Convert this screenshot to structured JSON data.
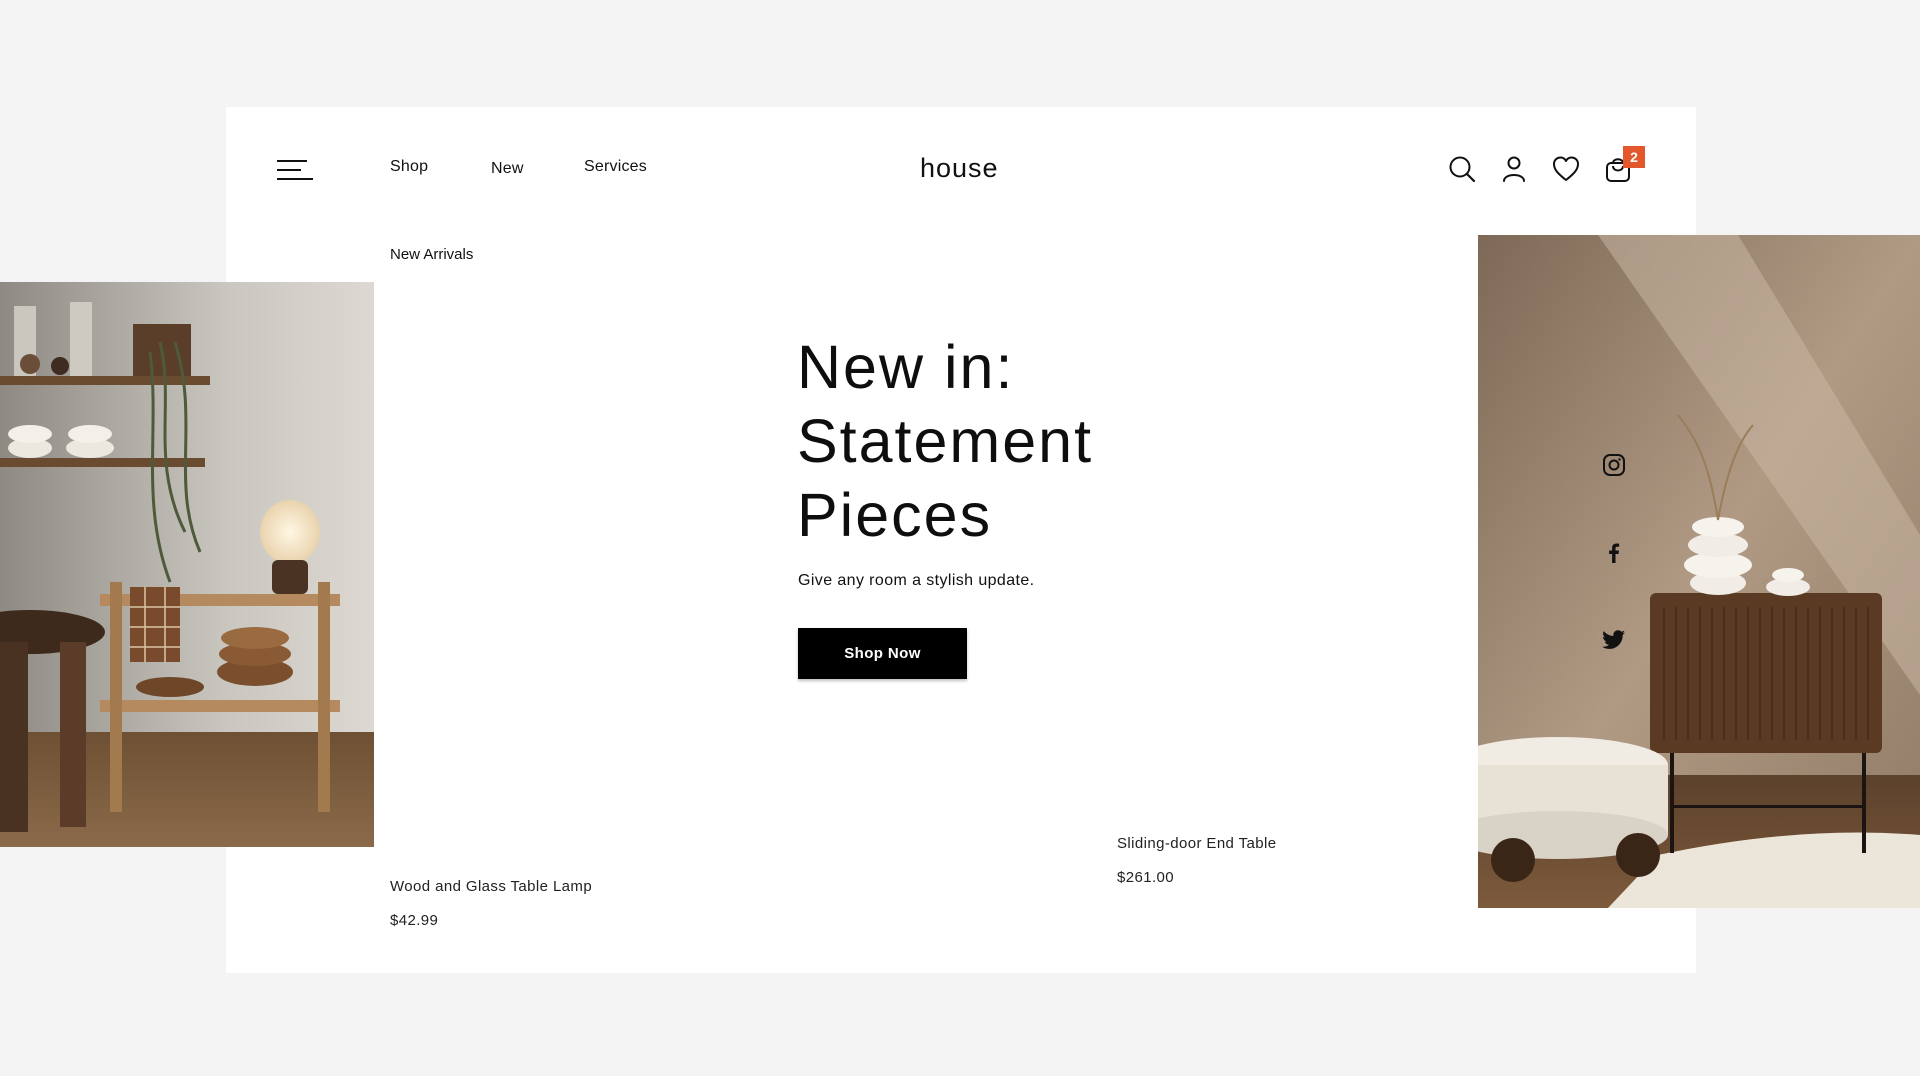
{
  "colors": {
    "background": "#f4f4f4",
    "card": "#ffffff",
    "text": "#111111",
    "badge": "#e2572b",
    "button_bg": "#000000",
    "button_text": "#ffffff"
  },
  "header": {
    "menu_icon": "hamburger-menu-icon",
    "nav": [
      "Shop",
      "New",
      "Services"
    ],
    "logo": "house",
    "icons": [
      "search-icon",
      "user-icon",
      "heart-icon",
      "bag-icon"
    ],
    "cart_count": "2"
  },
  "breadcrumb": "New Arrivals",
  "hero": {
    "title_lines": [
      "New in:",
      "Statement",
      "Pieces"
    ],
    "subtitle": "Give any room a stylish update.",
    "cta": "Shop Now"
  },
  "products": [
    {
      "name": "Wood and Glass Table Lamp",
      "price": "$42.99"
    },
    {
      "name": "Sliding-door End Table",
      "price": "$261.00"
    }
  ],
  "social": [
    "instagram-icon",
    "facebook-icon",
    "twitter-icon"
  ]
}
